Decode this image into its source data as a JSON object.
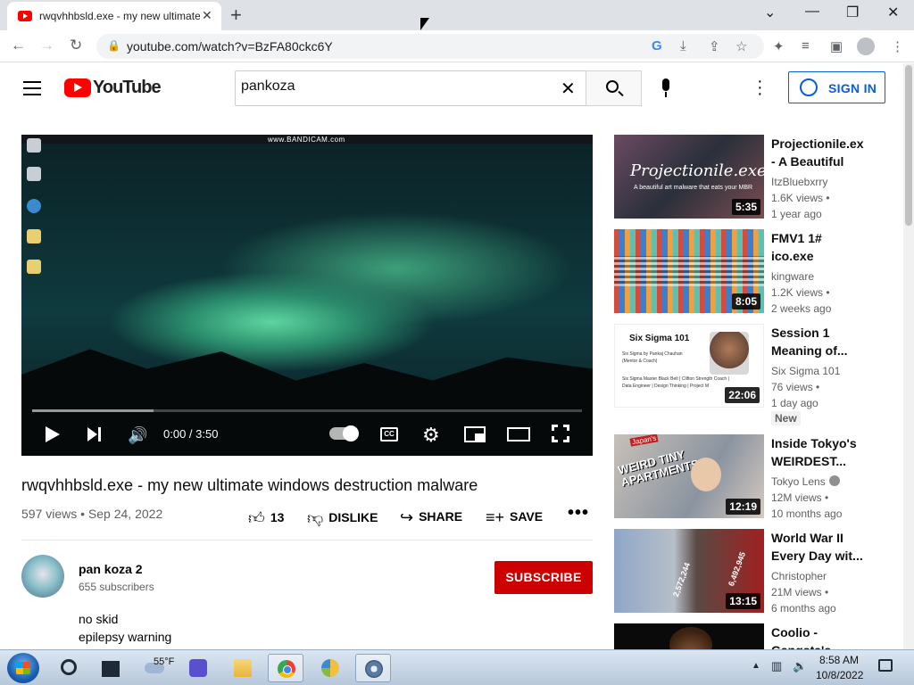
{
  "browser": {
    "tab_title": "rwqvhhbsld.exe - my new ultimate",
    "tab_close": "✕",
    "new_tab": "+",
    "url": "youtube.com/watch?v=BzFA80ckc6Y",
    "icons": {
      "minimize": "minimize-icon",
      "maximize": "maximize-icon",
      "close": "close-icon"
    }
  },
  "youtube": {
    "logo_text": "YouTube",
    "search_value": "pankoza",
    "search_placeholder": "Search",
    "signin_label": "SIGN IN",
    "colors": {
      "brand": "#ff0000",
      "signin": "#065fd4",
      "subscribe": "#cc0000"
    }
  },
  "player": {
    "watermark": "www.BANDICAM.com",
    "time": "0:00 / 3:50",
    "loaded_fraction": 0.22
  },
  "video": {
    "title": "rwqvhhbsld.exe - my new ultimate windows destruction malware",
    "meta": "597 views • Sep 24, 2022",
    "likes": "13",
    "dislike_label": "DISLIKE",
    "share_label": "SHARE",
    "save_label": "SAVE",
    "more": "•••"
  },
  "channel": {
    "name": "pan koza 2",
    "subscribers": "655 subscribers",
    "subscribe_label": "SUBSCRIBE",
    "description": [
      "no skid",
      "epilepsy warning"
    ]
  },
  "recommendations": [
    {
      "title": "Projectionile.exe - A Beautiful A...",
      "channel": "ItzBluebxrry",
      "views": "1.6K views •",
      "time": "1 year ago",
      "duration": "5:35",
      "thumb_text": "Projectionile.exe",
      "thumb_sub": "A beautiful art malware that eats your MBR"
    },
    {
      "title": "FMV1 1# ico.exe",
      "channel": "kingware",
      "views": "1.2K views •",
      "time": "2 weeks ago",
      "duration": "8:05"
    },
    {
      "title": "Session 1 Meaning of...",
      "channel": "Six Sigma 101",
      "views": "76 views •",
      "time": "1 day ago",
      "duration": "22:06",
      "badge": "New",
      "thumb_head": "Six Sigma 101",
      "thumb_lines": [
        "Six Sigma by Pankaj Chauhan",
        "(Mentor & Coach)",
        "Six Sigma Master Black Belt | Clifton Strength Coach |",
        "Data Engineer | Design Thinking | Project M"
      ]
    },
    {
      "title": "Inside Tokyo's WEIRDEST...",
      "channel": "Tokyo Lens",
      "views": "12M views •",
      "time": "10 months ago",
      "duration": "12:19",
      "thumb_text": "WEIRD TINY APARTMENTS",
      "thumb_small": "Japan's"
    },
    {
      "title": "World War II Every Day wit...",
      "channel": "Christopher",
      "views": "21M views •",
      "time": "6 months ago",
      "duration": "13:15",
      "thumb_lbl1": "6,492,945",
      "thumb_lbl2": "2,572,244"
    },
    {
      "title": "Coolio - Gangsta's...",
      "channel": "",
      "views": "",
      "time": "",
      "duration": ""
    }
  ],
  "taskbar": {
    "weather_temp": "55°F",
    "time": "8:58 AM",
    "date": "10/8/2022"
  }
}
